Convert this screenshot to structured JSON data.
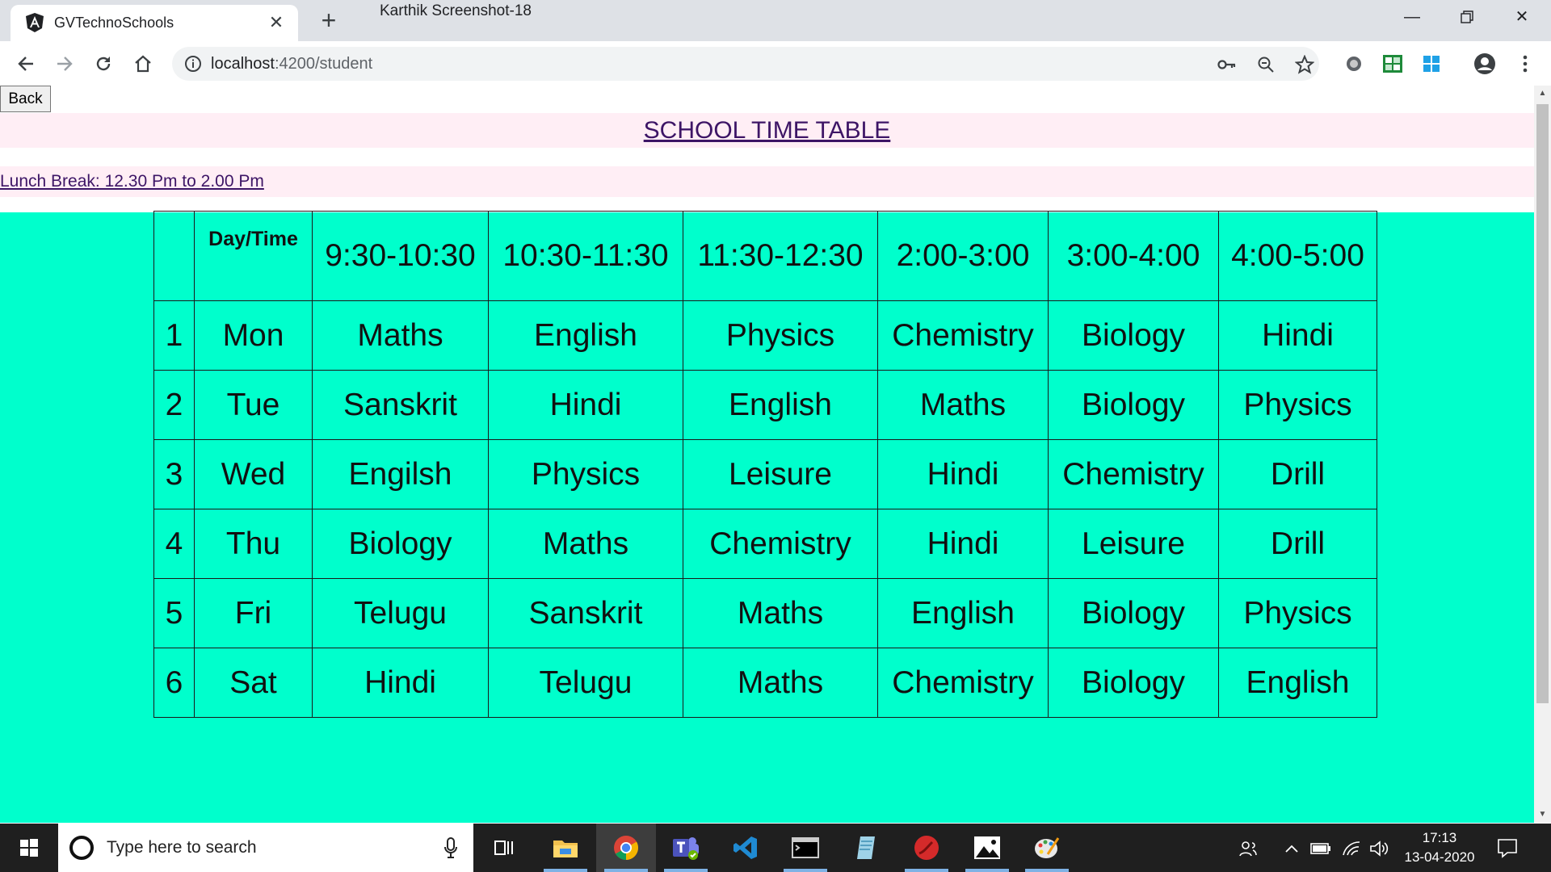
{
  "browser": {
    "tab_title": "GVTechnoSchools",
    "window_caption": "Karthik Screenshot-18",
    "url_host": "localhost",
    "url_rest": ":4200/student"
  },
  "page": {
    "back_label": "Back",
    "heading": "SCHOOL TIME TABLE",
    "lunch_note": "Lunch Break: 12.30 Pm to 2.00 Pm",
    "background_color": "#00ffcc",
    "link_color": "#3d1566"
  },
  "timetable": {
    "header": [
      "",
      "Day/Time",
      "9:30-10:30",
      "10:30-11:30",
      "11:30-12:30",
      "2:00-3:00",
      "3:00-4:00",
      "4:00-5:00"
    ],
    "rows": [
      [
        "1",
        "Mon",
        "Maths",
        "English",
        "Physics",
        "Chemistry",
        "Biology",
        "Hindi"
      ],
      [
        "2",
        "Tue",
        "Sanskrit",
        "Hindi",
        "English",
        "Maths",
        "Biology",
        "Physics"
      ],
      [
        "3",
        "Wed",
        "Engilsh",
        "Physics",
        "Leisure",
        "Hindi",
        "Chemistry",
        "Drill"
      ],
      [
        "4",
        "Thu",
        "Biology",
        "Maths",
        "Chemistry",
        "Hindi",
        "Leisure",
        "Drill"
      ],
      [
        "5",
        "Fri",
        "Telugu",
        "Sanskrit",
        "Maths",
        "English",
        "Biology",
        "Physics"
      ],
      [
        "6",
        "Sat",
        "Hindi",
        "Telugu",
        "Maths",
        "Chemistry",
        "Biology",
        "English"
      ]
    ]
  },
  "taskbar": {
    "search_placeholder": "Type here to search",
    "time": "17:13",
    "date": "13-04-2020",
    "apps": [
      "task-view-icon",
      "file-explorer-icon",
      "chrome-icon",
      "teams-icon",
      "vscode-icon",
      "terminal-icon",
      "notepad-icon",
      "red-app-icon",
      "photos-icon",
      "paint-icon"
    ]
  }
}
